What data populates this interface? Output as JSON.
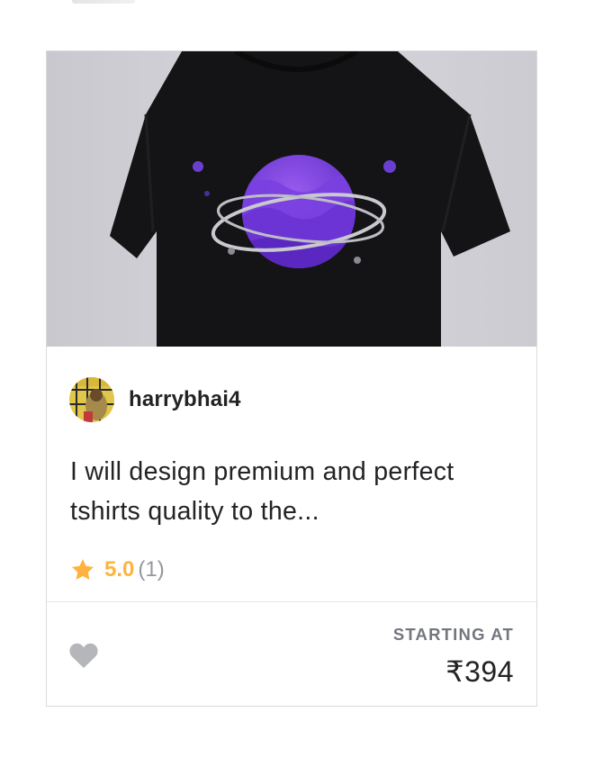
{
  "gig": {
    "seller_name": "harrybhai4",
    "title": "I will design premium and perfect tshirts quality to the...",
    "rating": "5.0",
    "rating_count": "(1)",
    "starting_label": "STARTING AT",
    "price": "₹394"
  },
  "icons": {
    "rating": "star-icon",
    "favorite": "heart-icon"
  },
  "colors": {
    "star": "#ffb33e",
    "heart": "#b5b6ba",
    "text": "#222325",
    "muted": "#74767e",
    "border": "#dadbdd"
  }
}
